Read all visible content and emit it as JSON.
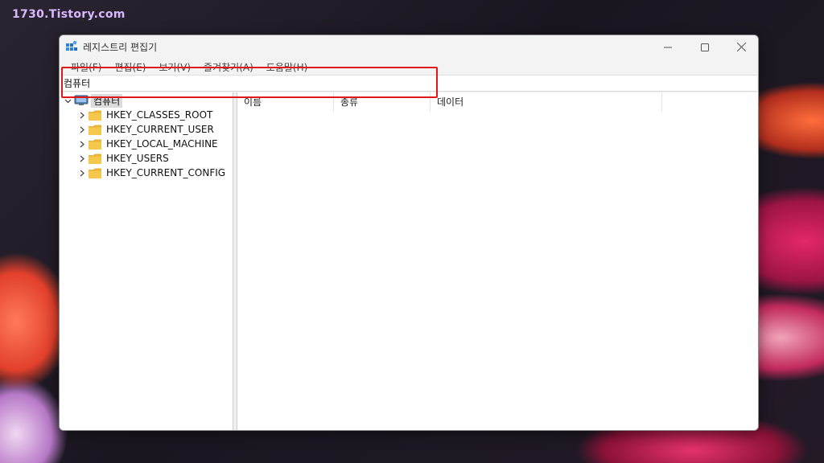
{
  "watermark": "1730.Tistory.com",
  "window": {
    "title": "레지스트리 편집기",
    "icon": "registry-editor-icon",
    "controls": {
      "minimize": "minimize-icon",
      "maximize": "maximize-icon",
      "close": "close-icon"
    }
  },
  "menu": [
    {
      "label": "파일(F)"
    },
    {
      "label": "편집(E)"
    },
    {
      "label": "보기(V)"
    },
    {
      "label": "즐겨찾기(A)"
    },
    {
      "label": "도움말(H)"
    }
  ],
  "address": {
    "value": "컴퓨터"
  },
  "tree": {
    "root": {
      "label": "컴퓨터",
      "icon": "computer-icon"
    },
    "children": [
      {
        "label": "HKEY_CLASSES_ROOT",
        "icon": "folder-icon"
      },
      {
        "label": "HKEY_CURRENT_USER",
        "icon": "folder-icon"
      },
      {
        "label": "HKEY_LOCAL_MACHINE",
        "icon": "folder-icon"
      },
      {
        "label": "HKEY_USERS",
        "icon": "folder-icon"
      },
      {
        "label": "HKEY_CURRENT_CONFIG",
        "icon": "folder-icon"
      }
    ]
  },
  "list": {
    "columns": [
      {
        "label": "이름"
      },
      {
        "label": "종류"
      },
      {
        "label": "데이터"
      }
    ]
  },
  "colors": {
    "highlight": "#e01818",
    "watermark": "#d9b8ff",
    "folder": "#f5c84c"
  }
}
